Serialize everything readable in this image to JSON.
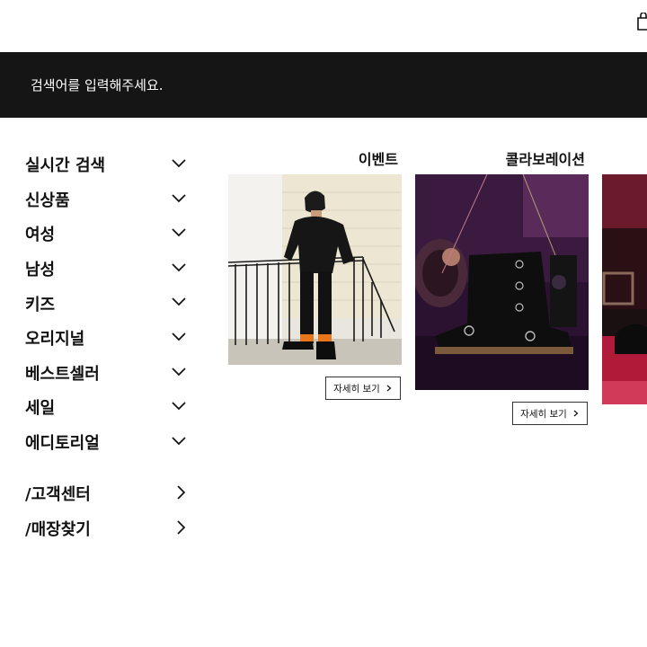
{
  "header": {
    "icons": [
      "shopping-bag-icon"
    ]
  },
  "search": {
    "placeholder": "검색어를 입력해주세요."
  },
  "menu": {
    "items": [
      {
        "label": "실시간 검색",
        "icon": "chevron-down-icon"
      },
      {
        "label": "신상품",
        "icon": "chevron-down-icon"
      },
      {
        "label": "여성",
        "icon": "chevron-down-icon"
      },
      {
        "label": "남성",
        "icon": "chevron-down-icon"
      },
      {
        "label": "키즈",
        "icon": "chevron-down-icon"
      },
      {
        "label": "오리지널",
        "icon": "chevron-down-icon"
      },
      {
        "label": "베스트셀러",
        "icon": "chevron-down-icon"
      },
      {
        "label": "세일",
        "icon": "chevron-down-icon"
      },
      {
        "label": "에디토리얼",
        "icon": "chevron-down-icon"
      }
    ],
    "secondary": [
      {
        "label": "/고객센터",
        "icon": "chevron-right-icon"
      },
      {
        "label": "/매장찾기",
        "icon": "chevron-right-icon"
      }
    ]
  },
  "cards": [
    {
      "title": "이벤트",
      "button_label": "자세히 보기",
      "image": "photo-man-in-black-jacket"
    },
    {
      "title": "콜라보레이션",
      "button_label": "자세히 보기",
      "image": "photo-black-boots-with-rings"
    },
    {
      "title": "",
      "button_label": "",
      "image": "photo-boot-on-red-stage"
    }
  ],
  "colors": {
    "search_bar_bg": "#151515",
    "text": "#111111",
    "background": "#ffffff"
  }
}
